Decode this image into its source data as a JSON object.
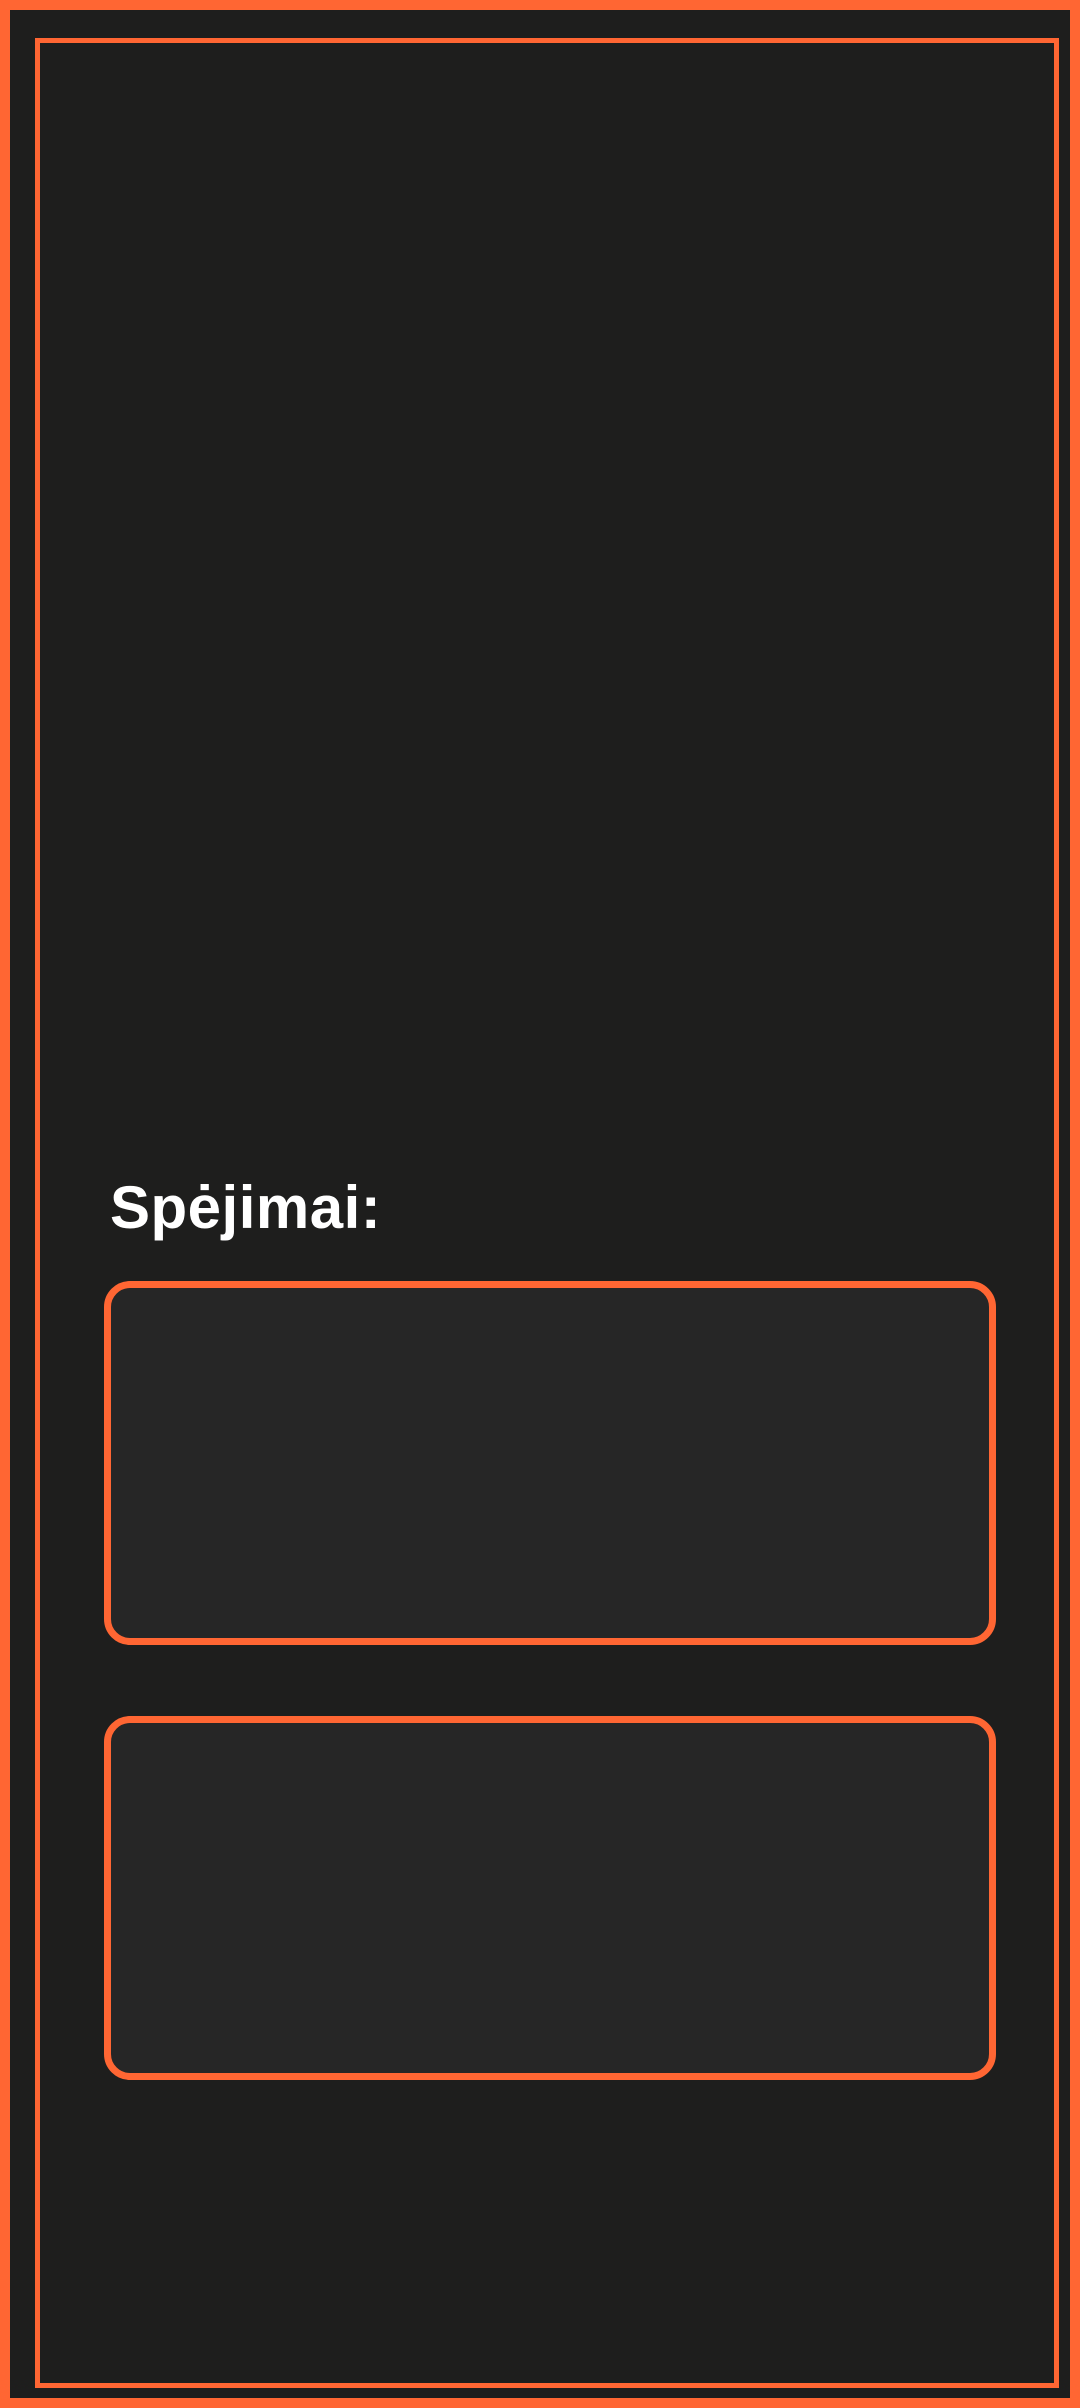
{
  "guesses_section": {
    "title": "Spėjimai:",
    "cards": [
      {
        "text": ""
      },
      {
        "text": ""
      }
    ]
  },
  "colors": {
    "accent": "#ff6633",
    "background": "#1e1e1d",
    "card_background": "#262626",
    "title_text": "#ffffff"
  }
}
